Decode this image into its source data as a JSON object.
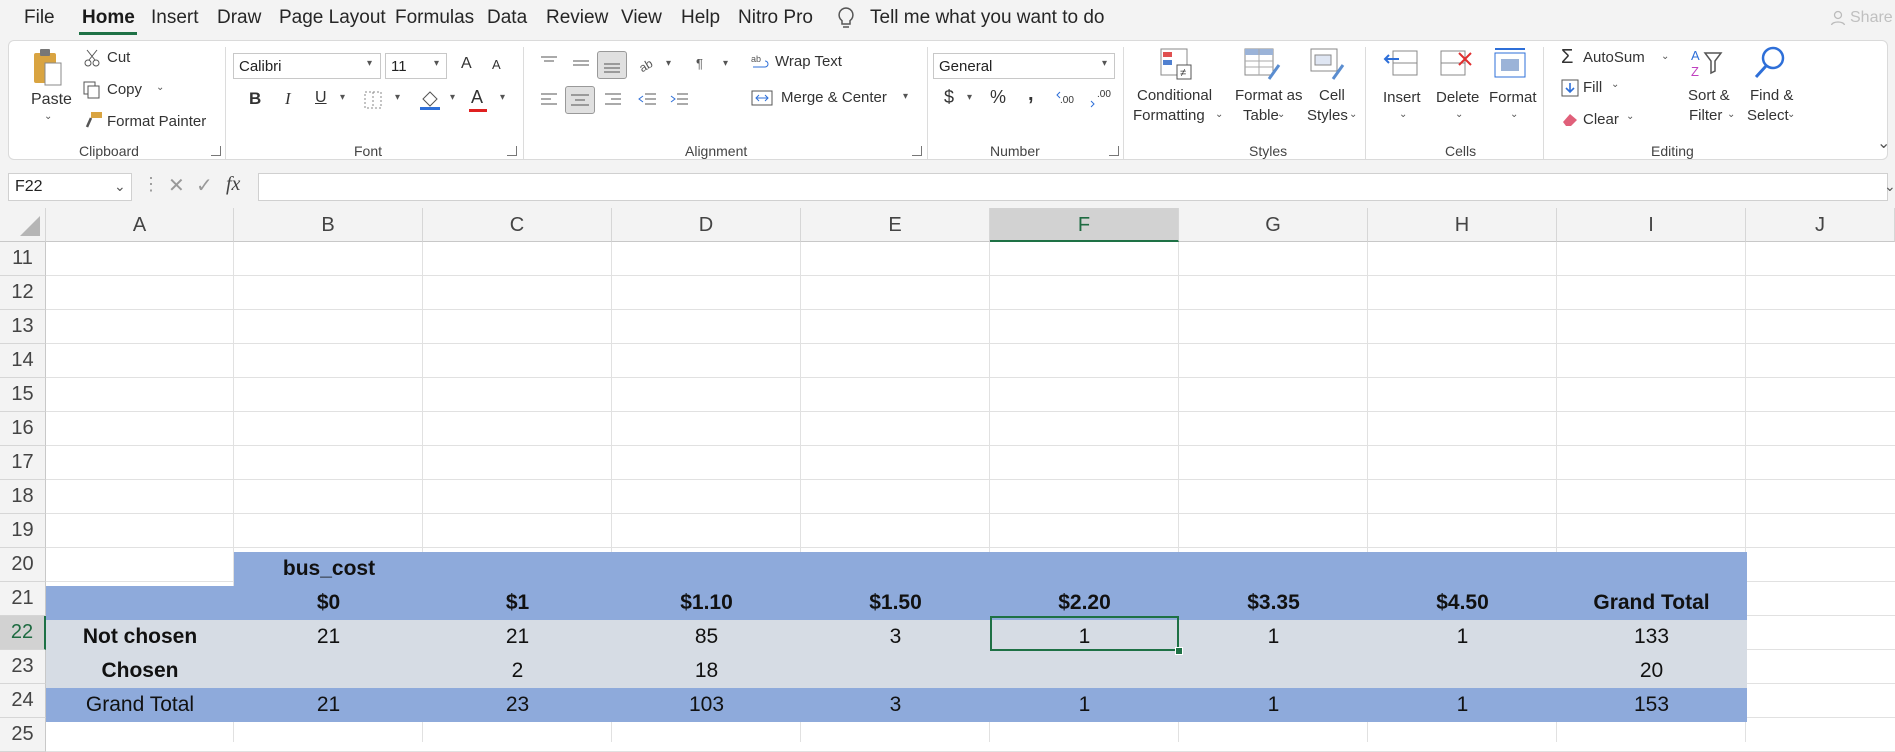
{
  "menu": {
    "items": [
      "File",
      "Home",
      "Insert",
      "Draw",
      "Page Layout",
      "Formulas",
      "Data",
      "Review",
      "View",
      "Help",
      "Nitro Pro"
    ],
    "tell_me": "Tell me what you want to do",
    "share": "Share"
  },
  "ribbon": {
    "clipboard": {
      "paste": "Paste",
      "cut": "Cut",
      "copy": "Copy",
      "format_painter": "Format Painter",
      "label": "Clipboard"
    },
    "font": {
      "name": "Calibri",
      "size": "11",
      "bold": "B",
      "italic": "I",
      "underline": "U",
      "grow": "A",
      "shrink": "A",
      "color": "A",
      "label": "Font"
    },
    "alignment": {
      "wrap_text": "Wrap Text",
      "merge_center": "Merge & Center",
      "label": "Alignment"
    },
    "number": {
      "format": "General",
      "currency": "$",
      "percent": "%",
      "comma": ",",
      "inc_decimal": ".00",
      "dec_decimal": ".00",
      "label": "Number"
    },
    "styles": {
      "conditional_1": "Conditional",
      "conditional_2": "Formatting",
      "format_table_1": "Format as",
      "format_table_2": "Table",
      "cell_styles_1": "Cell",
      "cell_styles_2": "Styles",
      "label": "Styles"
    },
    "cells": {
      "insert": "Insert",
      "delete": "Delete",
      "format": "Format",
      "label": "Cells"
    },
    "editing": {
      "autosum": "AutoSum",
      "fill": "Fill",
      "clear": "Clear",
      "sort_1": "Sort &",
      "sort_2": "Filter",
      "find_1": "Find &",
      "find_2": "Select",
      "label": "Editing"
    }
  },
  "formula_bar": {
    "name_box": "F22",
    "fx": "fx",
    "value": ""
  },
  "sheet": {
    "columns": [
      "A",
      "B",
      "C",
      "D",
      "E",
      "F",
      "G",
      "H",
      "I",
      "J"
    ],
    "rows": [
      "11",
      "12",
      "13",
      "14",
      "15",
      "16",
      "17",
      "18",
      "19",
      "20",
      "21",
      "22",
      "23",
      "24",
      "25"
    ],
    "selected_cell": "F22",
    "pivot": {
      "field_label": "bus_cost",
      "headers": [
        "$0",
        "$1",
        "$1.10",
        "$1.50",
        "$2.20",
        "$3.35",
        "$4.50",
        "Grand Total"
      ],
      "body": [
        {
          "label": "Not chosen",
          "values": [
            "21",
            "21",
            "85",
            "3",
            "1",
            "1",
            "1",
            "133"
          ]
        },
        {
          "label": "Chosen",
          "values": [
            "",
            "2",
            "18",
            "",
            "",
            "",
            "",
            "20"
          ]
        }
      ],
      "total": {
        "label": "Grand Total",
        "values": [
          "21",
          "23",
          "103",
          "3",
          "1",
          "1",
          "1",
          "153"
        ]
      }
    },
    "colors": {
      "pivot_blue": "#8eaadb",
      "pivot_gray": "#d6dce4",
      "accent_green": "#1e7145"
    }
  }
}
